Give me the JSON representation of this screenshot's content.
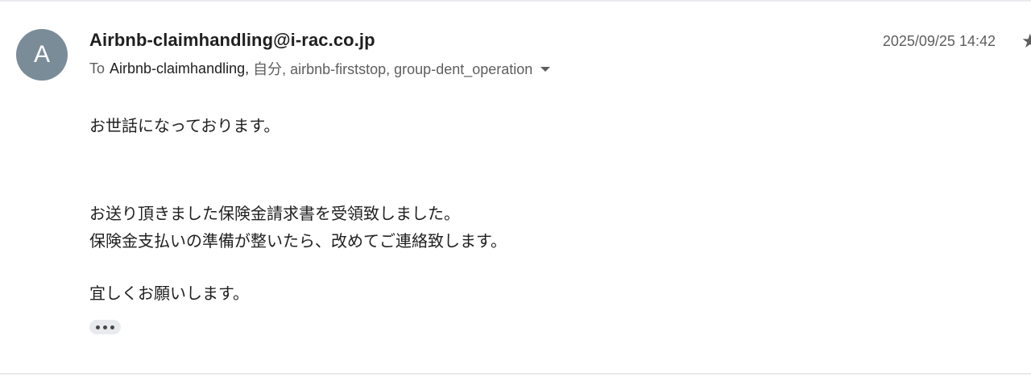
{
  "message": {
    "avatar_letter": "A",
    "sender_email": "Airbnb-claimhandling@i-rac.co.jp",
    "to_label": "To",
    "to_first": "Airbnb-claimhandling,",
    "to_rest": "自分, airbnb-firststop, group-dent_operation",
    "timestamp": "2025/09/25 14:42",
    "body_lines": [
      "お世話になっております。",
      "お送り頂きました保険金請求書を受領致しました。",
      "保険金支払いの準備が整いたら、改めてご連絡致します。",
      "宜しくお願いします。"
    ],
    "star_icon": "★"
  },
  "colors": {
    "avatar_bg": "#7b8c99",
    "text_primary": "#1f1f1f",
    "text_secondary": "#5e5e5e"
  }
}
